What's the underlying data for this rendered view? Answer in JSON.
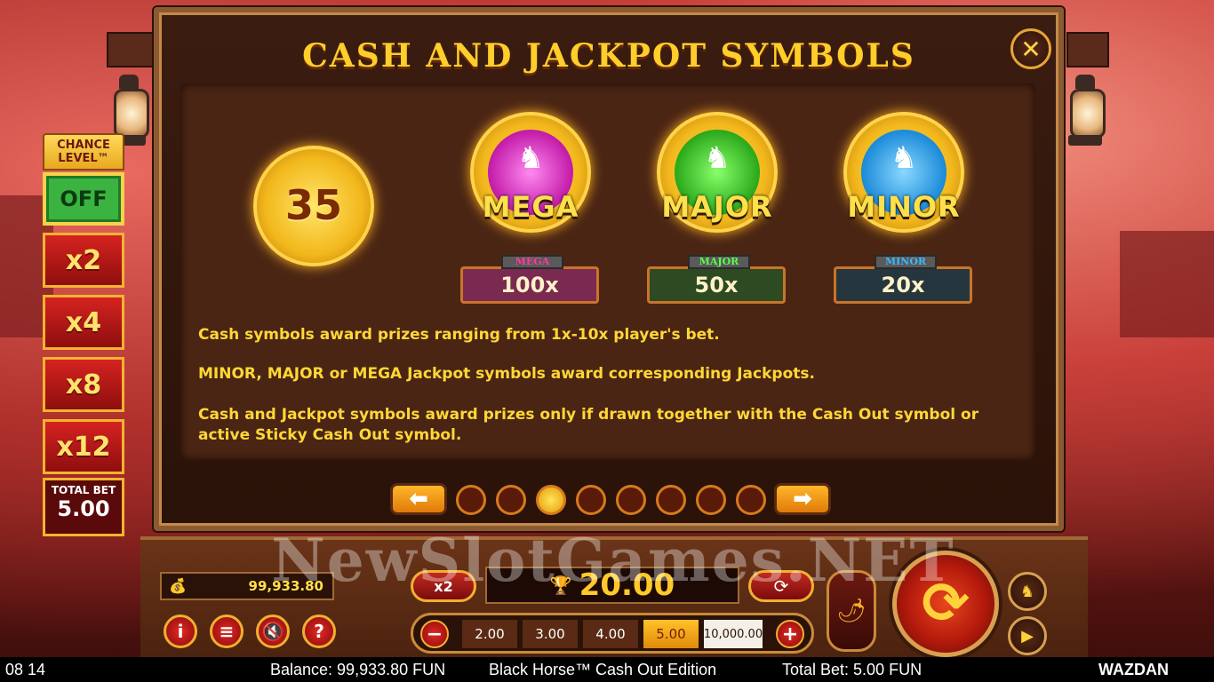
{
  "title": "CASH AND JACKPOT SYMBOLS",
  "close_icon": "close-icon",
  "chance_level": {
    "title": "CHANCE LEVEL™",
    "off_label": "OFF",
    "multipliers": [
      "x2",
      "x4",
      "x8",
      "x12"
    ],
    "total_bet_label": "TOTAL BET",
    "total_bet_value": "5.00"
  },
  "symbols": {
    "cash_value": "35",
    "jackpots": [
      {
        "name": "MEGA",
        "tag": "MEGA",
        "value": "100x",
        "color": "#e23cc8",
        "plate_color": "#7a2a50"
      },
      {
        "name": "MAJOR",
        "tag": "MAJOR",
        "value": "50x",
        "color": "#3ec82a",
        "plate_color": "#2e4a22"
      },
      {
        "name": "MINOR",
        "tag": "MINOR",
        "value": "20x",
        "color": "#2a9ae0",
        "plate_color": "#26363e"
      }
    ]
  },
  "info": {
    "line1": "Cash symbols award prizes ranging from 1x-10x player's bet.",
    "line2": "MINOR, MAJOR or MEGA Jackpot symbols award corresponding Jackpots.",
    "line3": "Cash and Jackpot symbols award prizes only if drawn together with the Cash Out symbol or active Sticky Cash Out symbol."
  },
  "pagination": {
    "total": 8,
    "active": 3
  },
  "controls": {
    "balance": "99,933.80",
    "x2_label": "x2",
    "win_value": "20.00",
    "bet_options": [
      "2.00",
      "3.00",
      "4.00",
      "5.00",
      "10,000.00"
    ],
    "selected_bet": "5.00",
    "minus": "−",
    "plus": "+"
  },
  "watermark": "NewSlotGames.NET",
  "status_bar": {
    "time": "08 14",
    "balance": "Balance: 99,933.80 FUN",
    "game": "Black Horse™ Cash Out Edition",
    "total_bet": "Total Bet: 5.00 FUN",
    "brand": "WAZDAN"
  }
}
